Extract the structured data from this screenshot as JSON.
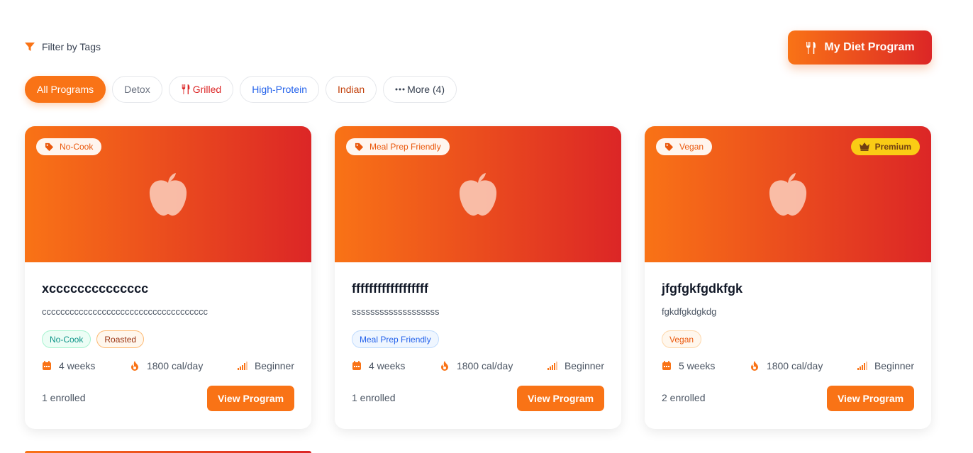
{
  "filter": {
    "label": "Filter by Tags"
  },
  "header": {
    "diet_button": "My Diet Program"
  },
  "chips": {
    "all": "All Programs",
    "detox": "Detox",
    "grilled": "Grilled",
    "high_protein": "High-Protein",
    "indian": "Indian",
    "more": "More (4)"
  },
  "cards": [
    {
      "tag": "No-Cook",
      "title": "xcccccccccccccc",
      "description": "cccccccccccccccccccccccccccccccccccc",
      "pills": [
        "No-Cook",
        "Roasted"
      ],
      "duration": "4 weeks",
      "calories": "1800 cal/day",
      "level": "Beginner",
      "enrolled": "1 enrolled",
      "button": "View Program"
    },
    {
      "tag": "Meal Prep Friendly",
      "title": "ffffffffffffffffff",
      "description": "sssssssssssssssssss",
      "pills": [
        "Meal Prep Friendly"
      ],
      "duration": "4 weeks",
      "calories": "1800 cal/day",
      "level": "Beginner",
      "enrolled": "1 enrolled",
      "button": "View Program"
    },
    {
      "tag": "Vegan",
      "premium": "Premium",
      "title": "jfgfgkfgdkfgk",
      "description": "fgkdfgkdgkdg",
      "pills": [
        "Vegan"
      ],
      "duration": "5 weeks",
      "calories": "1800 cal/day",
      "level": "Beginner",
      "enrolled": "2 enrolled",
      "button": "View Program"
    }
  ],
  "colors": {
    "accent": "#f97316",
    "gradient_end": "#dc2626",
    "premium": "#facc15"
  }
}
